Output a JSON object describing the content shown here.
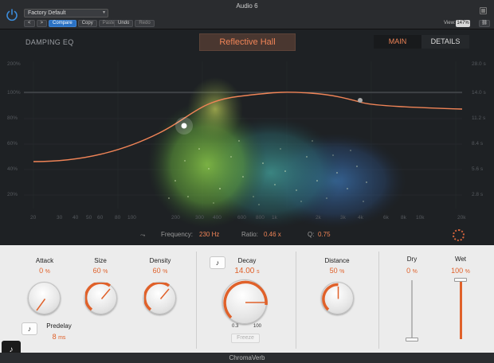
{
  "window": {
    "title": "Audio 6"
  },
  "toolbar": {
    "preset": "Factory Default",
    "compare": "Compare",
    "copy": "Copy",
    "paste": "Paste",
    "undo": "Undo",
    "redo": "Redo",
    "view_label": "View:",
    "view_value": "147%",
    "prev": "<",
    "next": ">"
  },
  "display": {
    "section_label": "DAMPING EQ",
    "room_type": "Reflective Hall",
    "tabs": [
      {
        "label": "MAIN",
        "selected": true
      },
      {
        "label": "DETAILS",
        "selected": false
      }
    ],
    "left_axis": [
      "200%",
      "100%",
      "80%",
      "60%",
      "40%",
      "20%"
    ],
    "right_axis": [
      "28.0 s",
      "14.0 s",
      "11.2 s",
      "8.4 s",
      "5.6 s",
      "2.8 s"
    ],
    "freq_axis": [
      "20",
      "30",
      "40",
      "50",
      "60",
      "80",
      "100",
      "200",
      "300",
      "400",
      "600",
      "800",
      "1k",
      "2k",
      "3k",
      "4k",
      "6k",
      "8k",
      "10k",
      "20k"
    ],
    "status": {
      "frequency_label": "Frequency:",
      "frequency_value": "230 Hz",
      "ratio_label": "Ratio:",
      "ratio_value": "0.46 x",
      "q_label": "Q:",
      "q_value": "0.75"
    },
    "accent_color": "#f08457"
  },
  "controls": {
    "attack": {
      "title": "Attack",
      "value": "0",
      "unit": "%",
      "level": 0.0
    },
    "size": {
      "title": "Size",
      "value": "60",
      "unit": "%",
      "level": 0.6
    },
    "density": {
      "title": "Density",
      "value": "60",
      "unit": "%",
      "level": 0.6
    },
    "predelay": {
      "title": "Predelay",
      "value": "8",
      "unit": "ms"
    },
    "decay": {
      "title": "Decay",
      "value": "14.00",
      "unit": "s",
      "min": "0.3",
      "max": "100",
      "freeze": "Freeze"
    },
    "distance": {
      "title": "Distance",
      "value": "50",
      "unit": "%",
      "level": 0.5
    },
    "dry": {
      "title": "Dry",
      "value": "0",
      "unit": "%",
      "level": 0.0
    },
    "wet": {
      "title": "Wet",
      "value": "100",
      "unit": "%",
      "level": 1.0
    }
  },
  "footer": {
    "plugin_name": "ChromaVerb"
  }
}
